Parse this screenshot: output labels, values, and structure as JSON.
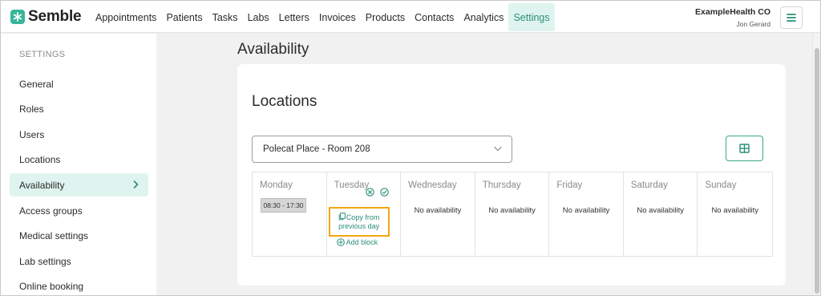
{
  "brand": {
    "name": "Semble",
    "accent": "#38b59a",
    "link_color": "#2a8f78",
    "highlight": "#f2a613"
  },
  "nav": {
    "items": [
      "Appointments",
      "Patients",
      "Tasks",
      "Labs",
      "Letters",
      "Invoices",
      "Products",
      "Contacts",
      "Analytics",
      "Settings"
    ],
    "active": "Settings"
  },
  "account": {
    "org": "ExampleHealth CO",
    "user": "Jon Gerard",
    "menu_icon": "hamburger-icon"
  },
  "sidebar": {
    "heading": "SETTINGS",
    "items": [
      "General",
      "Roles",
      "Users",
      "Locations",
      "Availability",
      "Access groups",
      "Medical settings",
      "Lab settings",
      "Online booking"
    ],
    "active": "Availability"
  },
  "page": {
    "title": "Availability"
  },
  "card": {
    "title": "Locations",
    "location_select": {
      "value": "Polecat Place - Room 208"
    },
    "view_toggle_icon": "grid-view-icon"
  },
  "week": {
    "days": [
      {
        "name": "Monday",
        "block": "08:30 - 17:30"
      },
      {
        "name": "Tuesday",
        "copy_label": "Copy from previous day",
        "add_label": "Add block"
      },
      {
        "name": "Wednesday",
        "status": "No availability"
      },
      {
        "name": "Thursday",
        "status": "No availability"
      },
      {
        "name": "Friday",
        "status": "No availability"
      },
      {
        "name": "Saturday",
        "status": "No availability"
      },
      {
        "name": "Sunday",
        "status": "No availability"
      }
    ]
  }
}
